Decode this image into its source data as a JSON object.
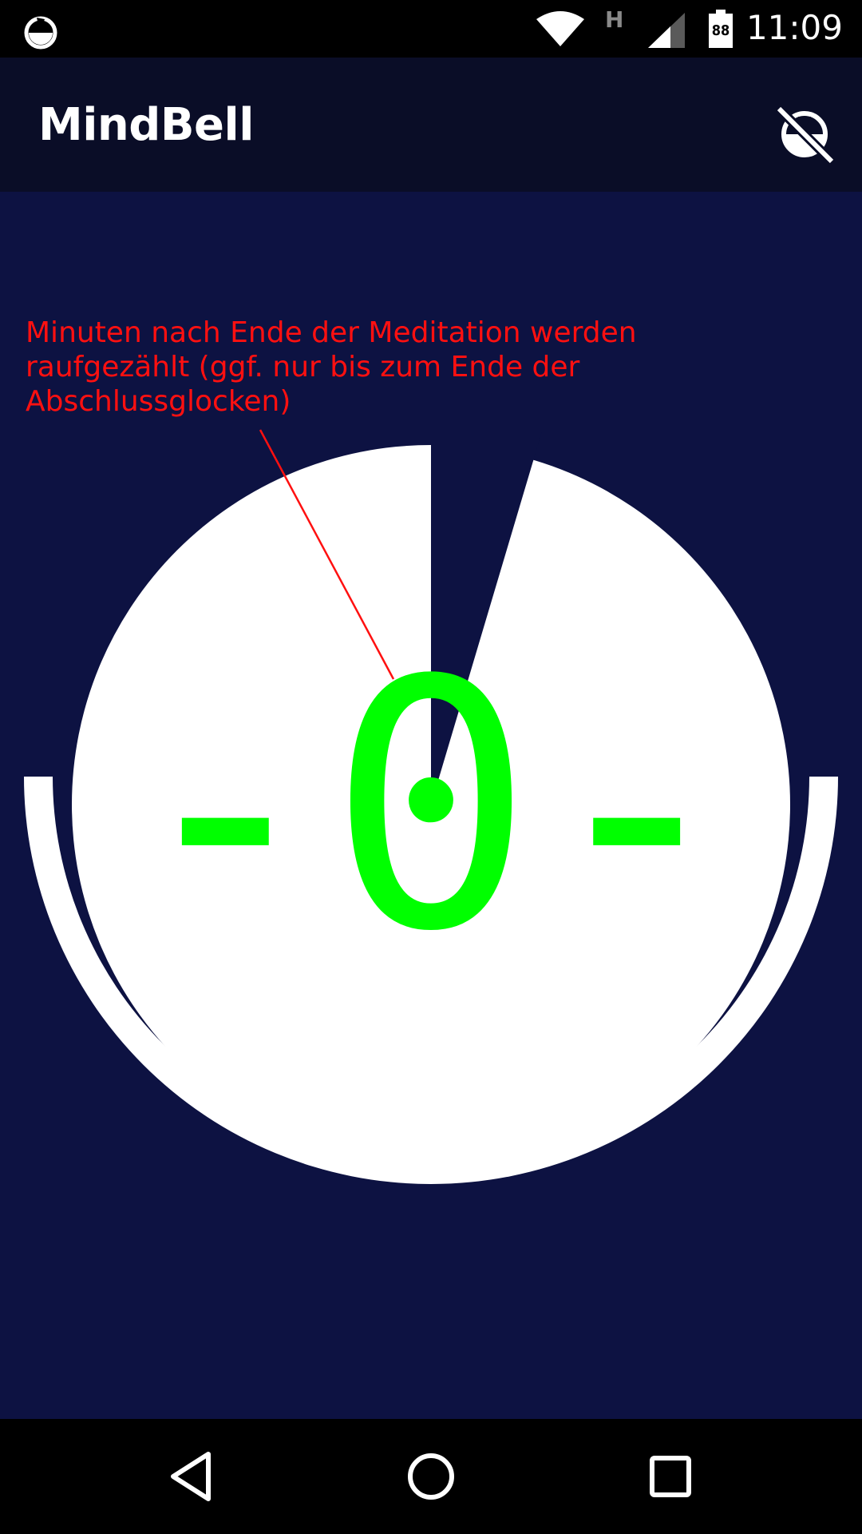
{
  "status_bar": {
    "app_icon": "mindbell-app-icon",
    "wifi_icon": "wifi-icon",
    "network_type": "H",
    "signal_icon": "cell-signal-icon",
    "battery_level": "88",
    "time": "11:09"
  },
  "app_bar": {
    "title": "MindBell",
    "mute_icon": "bell-muted-icon"
  },
  "main": {
    "annotation": "Minuten nach Ende der Meditation werden\nraufgezählt (ggf. nur bis zum Ende der\nAbschlussglocken)",
    "countdown": "-0-",
    "colors": {
      "background": "#0d1242",
      "dial": "#ffffff",
      "countdown": "#00ff00",
      "annotation": "#ff1010"
    }
  },
  "nav_bar": {
    "back_icon": "back-triangle-icon",
    "home_icon": "home-circle-icon",
    "recents_icon": "recents-square-icon"
  }
}
